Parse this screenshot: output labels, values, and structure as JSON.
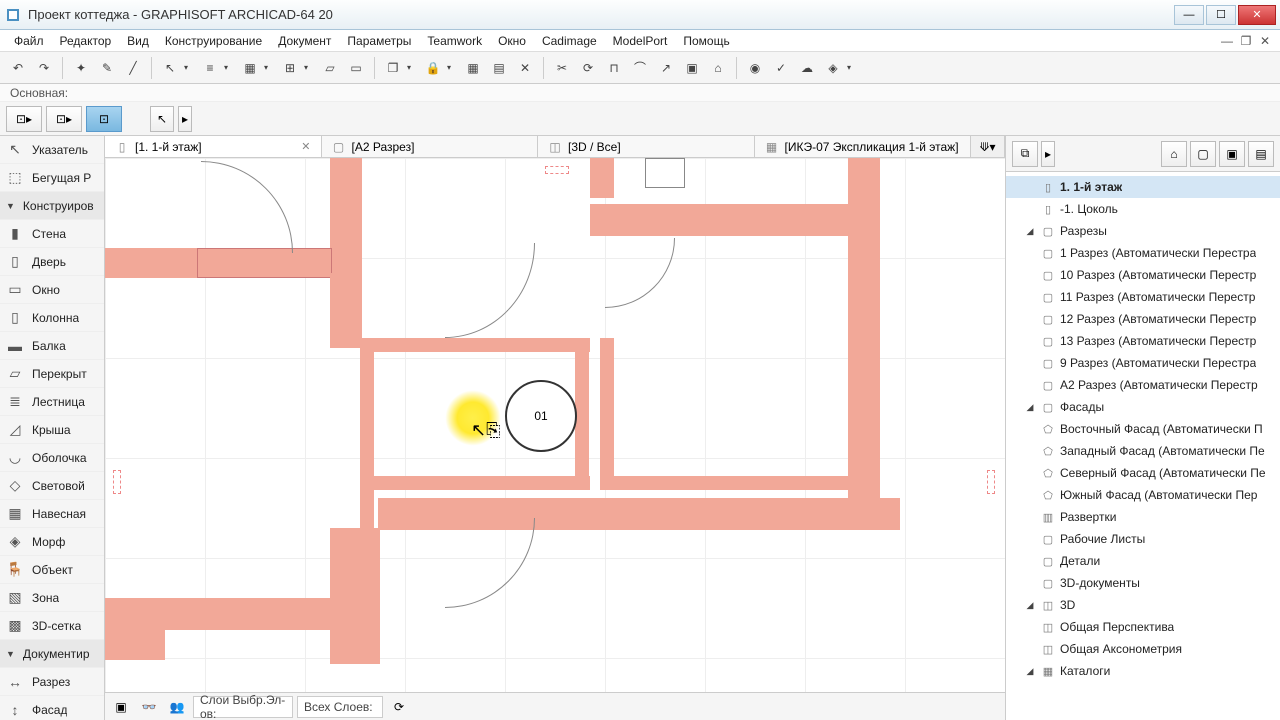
{
  "title": "Проект коттеджа - GRAPHISOFT ARCHICAD-64 20",
  "menu": [
    "Файл",
    "Редактор",
    "Вид",
    "Конструирование",
    "Документ",
    "Параметры",
    "Teamwork",
    "Окно",
    "Cadimage",
    "ModelPort",
    "Помощь"
  ],
  "baseline_label": "Основная:",
  "tabs": [
    {
      "label": "[1. 1-й этаж]",
      "active": true,
      "closable": true
    },
    {
      "label": "[A2 Разрез]",
      "active": false,
      "closable": false
    },
    {
      "label": "[3D / Все]",
      "active": false,
      "closable": false
    },
    {
      "label": "[ИКЭ-07 Экспликация 1-й этаж]",
      "active": false,
      "closable": false
    }
  ],
  "toolbox": {
    "pointer": "Указатель",
    "marquee": "Бегущая Р",
    "construct_header": "Конструиров",
    "construct_items": [
      "Стена",
      "Дверь",
      "Окно",
      "Колонна",
      "Балка",
      "Перекрыт",
      "Лестница",
      "Крыша",
      "Оболочка",
      "Световой",
      "Навесная",
      "Морф",
      "Объект",
      "Зона",
      "3D-сетка"
    ],
    "document_header": "Документир",
    "document_items": [
      "Разрез",
      "Фасад"
    ]
  },
  "marker_text": "01",
  "status": {
    "layers_sel_label": "Слои Выбр.Эл-ов:",
    "all_layers_label": "Всех Слоев:"
  },
  "navigator": {
    "current_floor": "1. 1-й этаж",
    "basement": "-1. Цоколь",
    "sections_header": "Разрезы",
    "sections": [
      "1 Разрез (Автоматически Перестра",
      "10 Разрез (Автоматически Перестр",
      "11 Разрез (Автоматически Перестр",
      "12 Разрез (Автоматически Перестр",
      "13 Разрез (Автоматически Перестр",
      "9 Разрез (Автоматически Перестра",
      "A2 Разрез (Автоматически Перестр"
    ],
    "elevations_header": "Фасады",
    "elevations": [
      "Восточный Фасад (Автоматически П",
      "Западный Фасад (Автоматически Пе",
      "Северный Фасад (Автоматически Пе",
      "Южный Фасад (Автоматически Пер"
    ],
    "interior_elev": "Развертки",
    "worksheets": "Рабочие Листы",
    "details": "Детали",
    "docs3d": "3D-документы",
    "header3d": "3D",
    "persp": "Общая Перспектива",
    "axo": "Общая Аксонометрия",
    "catalogs": "Каталоги"
  }
}
